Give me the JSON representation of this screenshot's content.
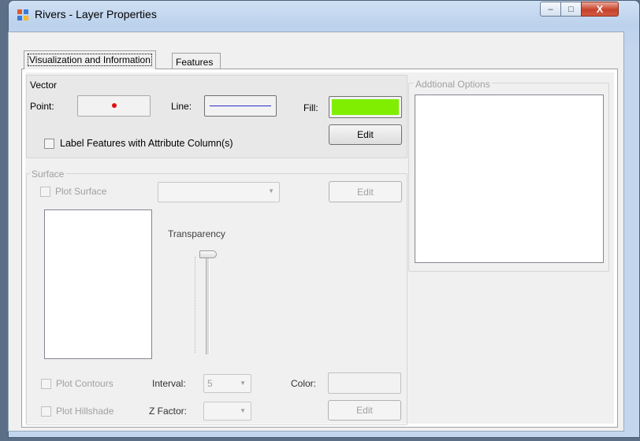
{
  "window": {
    "title": "Rivers - Layer Properties",
    "icon": "layer-grid-icon",
    "controls": {
      "minimize": "–",
      "maximize": "□",
      "close": "X"
    }
  },
  "tabs": [
    {
      "label": "Visualization and Information",
      "active": true
    },
    {
      "label": "Features",
      "active": false
    }
  ],
  "vector": {
    "title": "Vector",
    "point_label": "Point:",
    "line_label": "Line:",
    "fill_label": "Fill:",
    "edit_label": "Edit",
    "label_features": "Label Features with Attribute Column(s)",
    "point_color": "#e01010",
    "line_color": "#2b2bc8",
    "fill_color": "#80ee00"
  },
  "options": {
    "title": "Addtional Options"
  },
  "surface": {
    "title": "Surface",
    "plot_surface": "Plot Surface",
    "edit_label": "Edit",
    "transparency_label": "Transparency",
    "plot_contours": "Plot Contours",
    "interval_label": "Interval:",
    "interval_value": "5",
    "color_label": "Color:",
    "plot_hillshade": "Plot Hillshade",
    "zfactor_label": "Z Factor:",
    "hillshade_edit_label": "Edit"
  }
}
